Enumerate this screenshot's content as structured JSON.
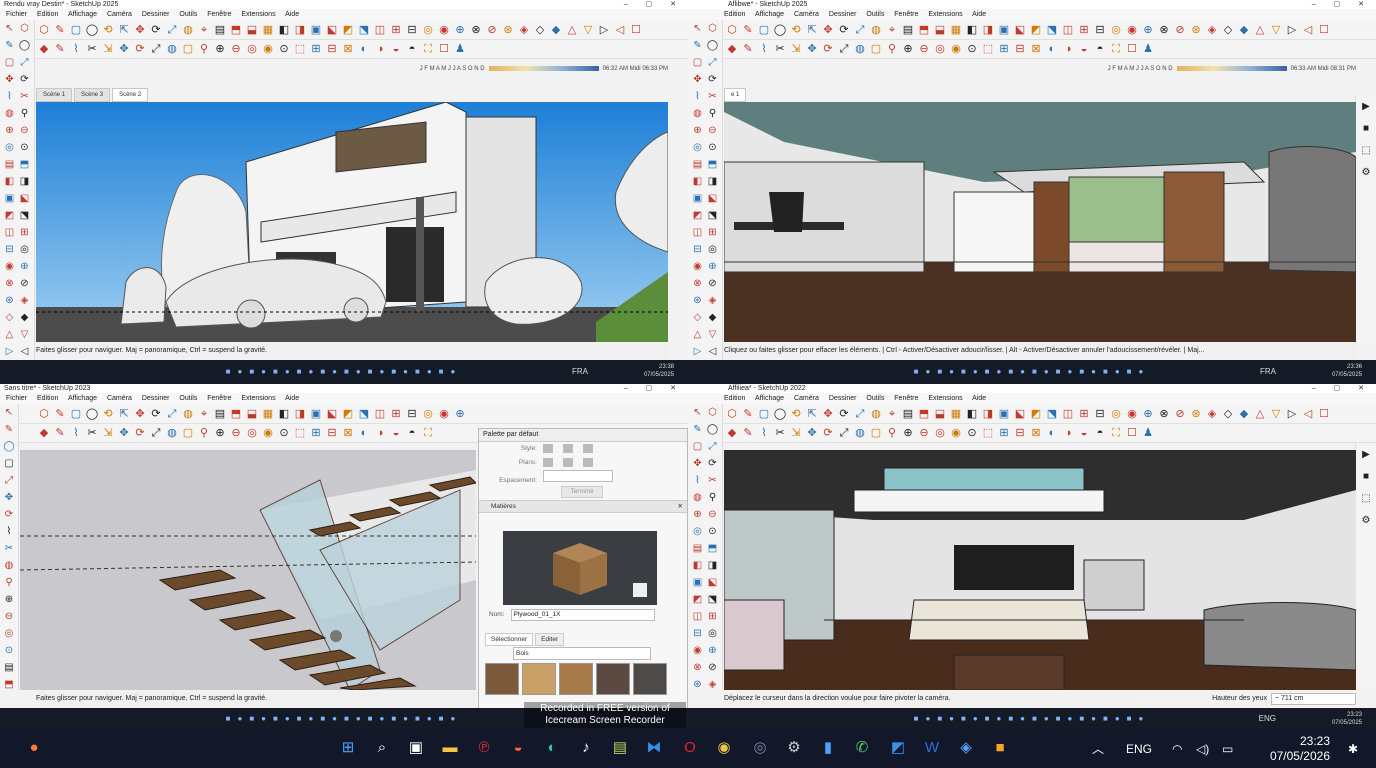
{
  "q1": {
    "title": "Rendu vray Destin* - SketchUp 2025",
    "menus": [
      "Fichier",
      "Edition",
      "Affichage",
      "Caméra",
      "Dessiner",
      "Outils",
      "Fenêtre",
      "Extensions",
      "Aide"
    ],
    "sun": {
      "months": "J F M A M J J A S O N D",
      "t1": "06:32 AM",
      "mid": "Midi",
      "t2": "06:33 PM"
    },
    "tabs": [
      "Scène 1",
      "Scène 3",
      "Scène 2"
    ],
    "status": "Faites glisser pour naviguer. Maj = panoramique, Ctrl = suspend la gravité.",
    "lang": "FRA",
    "clock": {
      "time": "23:38",
      "date": "07/05/2025"
    }
  },
  "q2": {
    "title": "Aflibwe* - SketchUp 2025",
    "menus": [
      "Edition",
      "Affichage",
      "Caméra",
      "Dessiner",
      "Outils",
      "Fenêtre",
      "Extensions",
      "Aide"
    ],
    "sun": {
      "months": "J F M A M J J A S O N D",
      "t1": "06:33 AM",
      "mid": "Midi",
      "t2": "08:31 PM"
    },
    "tabs": [
      "e 1"
    ],
    "status": "Cliquez ou faites glisser pour effacer les éléments. | Ctrl - Activer/Désactiver adoucir/lisser. | Alt - Activer/Désactiver annuler l'adoucissement/révéler. | Maj...",
    "lang": "FRA",
    "clock": {
      "time": "23:36",
      "date": "07/05/2025"
    }
  },
  "q3": {
    "title": "Sans titre* - SketchUp 2023",
    "menus": [
      "Fichier",
      "Edition",
      "Affichage",
      "Caméra",
      "Dessiner",
      "Outils",
      "Fenêtre",
      "Extensions",
      "Aide"
    ],
    "status": "Faites glisser pour naviguer. Maj = panoramique, Ctrl = suspend la gravité.",
    "panel": {
      "title": "Palette par défaut",
      "style_label": "Style:",
      "plans_label": "Plans:",
      "spacing_label": "Espacement:",
      "done_button": "Terminé",
      "section": "Matières",
      "name_label": "Nom:",
      "name_value": "Plywood_01_1X",
      "tab_select": "Sélectionner",
      "tab_edit": "Editer",
      "filter_value": "Bois"
    },
    "watermark_line1": "Recorded in FREE version of",
    "watermark_line2": "Icecream Screen Recorder"
  },
  "q4": {
    "title": "Affiliea* - SketchUp 2022",
    "menus": [
      "Edition",
      "Affichage",
      "Caméra",
      "Dessiner",
      "Outils",
      "Fenêtre",
      "Extensions",
      "Aide"
    ],
    "status": "Déplacez le curseur dans la direction voulue pour faire pivoter la caméra.",
    "height_label": "Hauteur des yeux",
    "height_value": "~ 711 cm",
    "lang": "ENG",
    "clock": {
      "time": "23:23",
      "date": "07/05/2025"
    }
  },
  "taskbar": {
    "lang": "ENG",
    "time": "23:23",
    "date": "07/05/2026",
    "icons": [
      "start-icon",
      "search-icon",
      "task-view-icon",
      "file-explorer-icon",
      "pinterest-icon",
      "app-orange-icon",
      "edge-icon",
      "tiktok-icon",
      "notepad-icon",
      "vscode-icon",
      "opera-icon",
      "chrome-icon",
      "settings-icon",
      "terminal-icon",
      "screen-recorder-icon",
      "whatsapp-icon",
      "photoshop-icon",
      "word-icon",
      "sketchup-icon",
      "app-yellow-icon"
    ]
  }
}
